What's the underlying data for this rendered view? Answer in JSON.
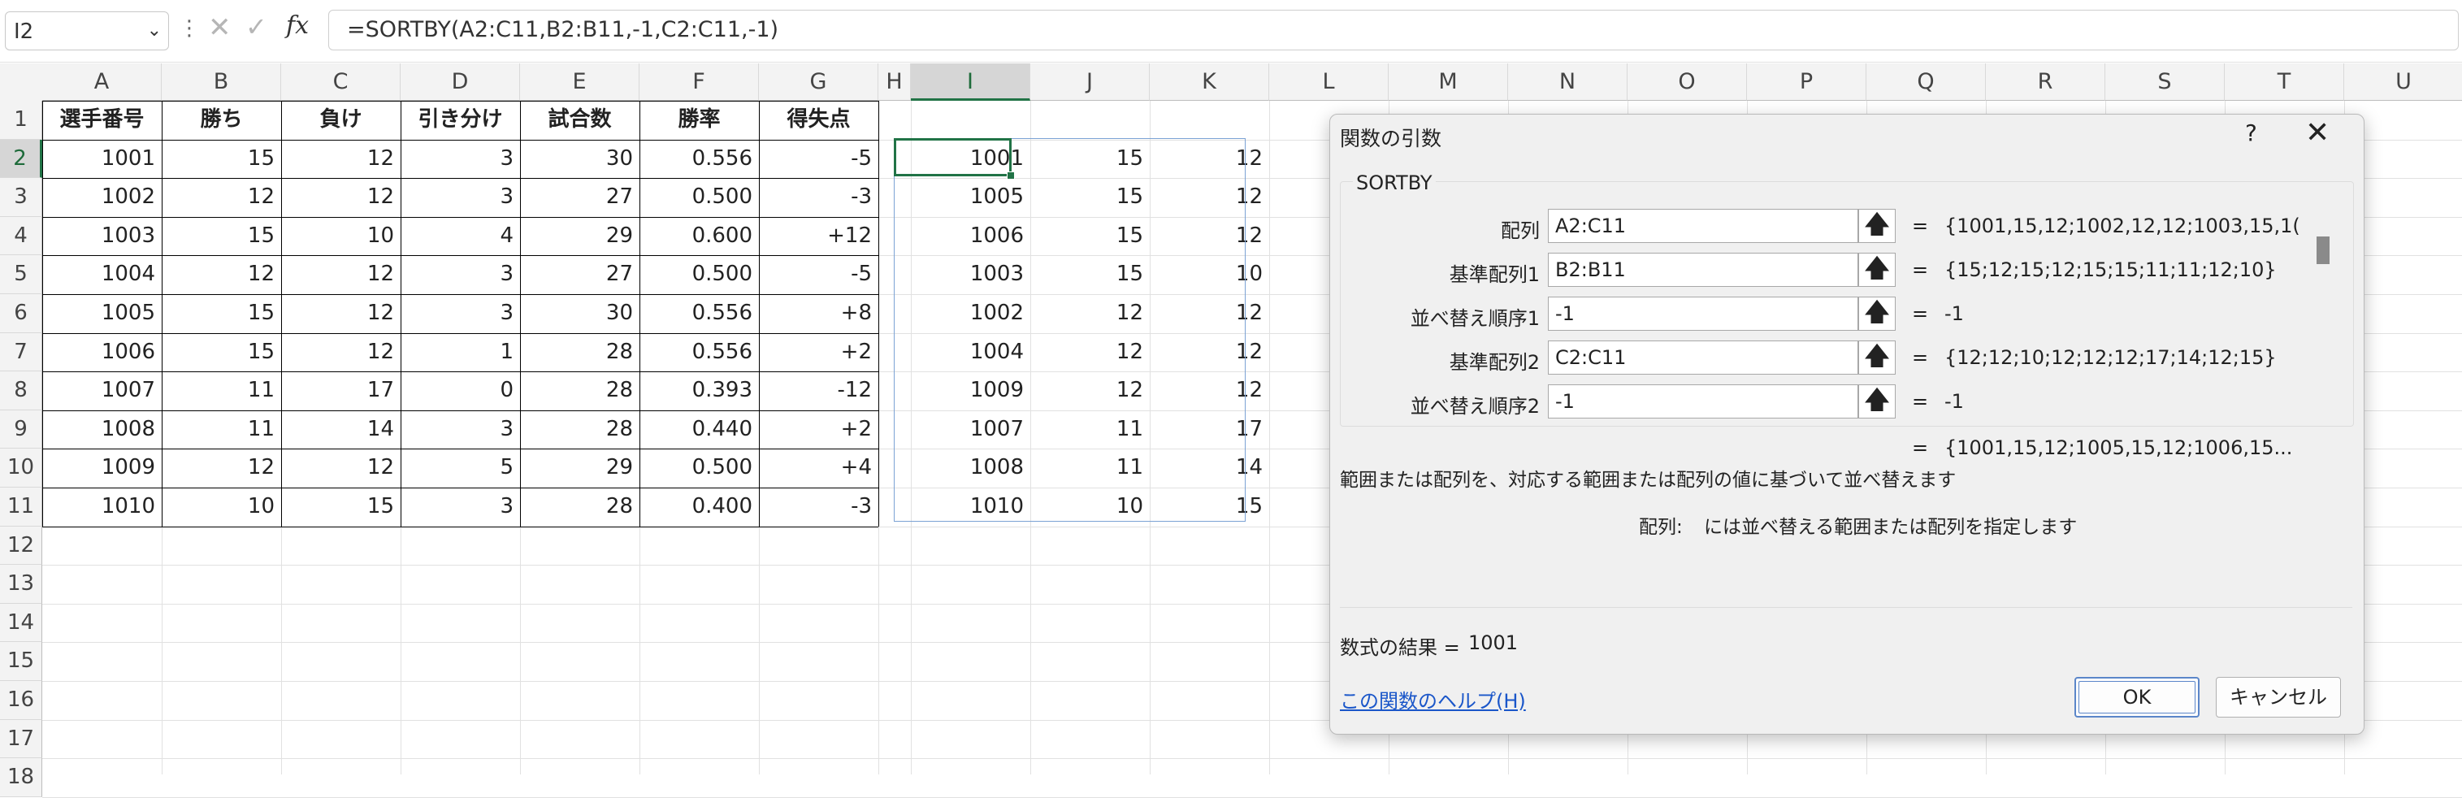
{
  "formula_bar": {
    "name_box": "I2",
    "separator": "⋮",
    "cancel_glyph": "✕",
    "enter_glyph": "✓",
    "fx_label": "fx",
    "formula": "=SORTBY(A2:C11,B2:B11,-1,C2:C11,-1)"
  },
  "columns": [
    "A",
    "B",
    "C",
    "D",
    "E",
    "F",
    "G",
    "H",
    "I",
    "J",
    "K",
    "L",
    "M",
    "N",
    "O",
    "P",
    "Q",
    "R",
    "S",
    "T",
    "U"
  ],
  "selected_column": "I",
  "selected_row": "2",
  "rows": [
    "1",
    "2",
    "3",
    "4",
    "5",
    "6",
    "7",
    "8",
    "9",
    "10",
    "11",
    "12",
    "13",
    "14",
    "15",
    "16",
    "17",
    "18"
  ],
  "table": {
    "headers": [
      "選手番号",
      "勝ち",
      "負け",
      "引き分け",
      "試合数",
      "勝率",
      "得失点"
    ],
    "rows": [
      [
        "1001",
        "15",
        "12",
        "3",
        "30",
        "0.556",
        "-5"
      ],
      [
        "1002",
        "12",
        "12",
        "3",
        "27",
        "0.500",
        "-3"
      ],
      [
        "1003",
        "15",
        "10",
        "4",
        "29",
        "0.600",
        "+12"
      ],
      [
        "1004",
        "12",
        "12",
        "3",
        "27",
        "0.500",
        "-5"
      ],
      [
        "1005",
        "15",
        "12",
        "3",
        "30",
        "0.556",
        "+8"
      ],
      [
        "1006",
        "15",
        "12",
        "1",
        "28",
        "0.556",
        "+2"
      ],
      [
        "1007",
        "11",
        "17",
        "0",
        "28",
        "0.393",
        "-12"
      ],
      [
        "1008",
        "11",
        "14",
        "3",
        "28",
        "0.440",
        "+2"
      ],
      [
        "1009",
        "12",
        "12",
        "5",
        "29",
        "0.500",
        "+4"
      ],
      [
        "1010",
        "10",
        "15",
        "3",
        "28",
        "0.400",
        "-3"
      ]
    ]
  },
  "spill_result": [
    [
      "1001",
      "15",
      "12"
    ],
    [
      "1005",
      "15",
      "12"
    ],
    [
      "1006",
      "15",
      "12"
    ],
    [
      "1003",
      "15",
      "10"
    ],
    [
      "1002",
      "12",
      "12"
    ],
    [
      "1004",
      "12",
      "12"
    ],
    [
      "1009",
      "12",
      "12"
    ],
    [
      "1007",
      "11",
      "17"
    ],
    [
      "1008",
      "11",
      "14"
    ],
    [
      "1010",
      "10",
      "15"
    ]
  ],
  "dialog": {
    "title": "関数の引数",
    "help_glyph": "?",
    "close_glyph": "✕",
    "function_name": "SORTBY",
    "args": [
      {
        "label": "配列",
        "input": "A2:C11",
        "eq": "=",
        "value": "{1001,15,12;1002,12,12;1003,15,1("
      },
      {
        "label": "基準配列1",
        "input": "B2:B11",
        "eq": "=",
        "value": "{15;12;15;12;15;15;11;11;12;10}"
      },
      {
        "label": "並べ替え順序1",
        "input": "-1",
        "eq": "=",
        "value": "-1"
      },
      {
        "label": "基準配列2",
        "input": "C2:C11",
        "eq": "=",
        "value": "{12;12;10;12;12;12;17;14;12;15}"
      },
      {
        "label": "並べ替え順序2",
        "input": "-1",
        "eq": "=",
        "value": "-1"
      }
    ],
    "ref_button_glyph": "🡅",
    "result_eq": "=",
    "result_preview": "{1001,15,12;1005,15,12;1006,15...",
    "description": "範囲または配列を、対応する範囲または配列の値に基づいて並べ替えます",
    "arg_desc_label": "配列:",
    "arg_desc_text": "には並べ替える範囲または配列を指定します",
    "formula_result_label": "数式の結果 =",
    "formula_result_value": "1001",
    "help_link": "この関数のヘルプ(H)",
    "ok_label": "OK",
    "cancel_label": "キャンセル"
  },
  "colors": {
    "selection_green": "#217346",
    "spill_blue": "#7ba2d4",
    "link_blue": "#1a56c9"
  }
}
